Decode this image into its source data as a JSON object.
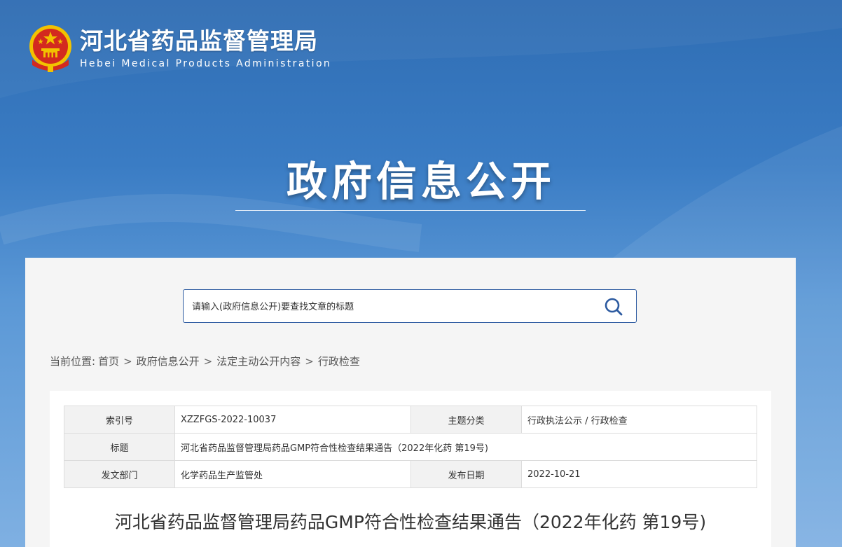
{
  "header": {
    "site_name_cn": "河北省药品监督管理局",
    "site_name_en": "Hebei Medical Products Administration",
    "hero_title": "政府信息公开"
  },
  "search": {
    "placeholder": "请输入(政府信息公开)要查找文章的标题"
  },
  "breadcrumb": {
    "prefix": "当前位置:",
    "items": [
      "首页",
      "政府信息公开",
      "法定主动公开内容",
      "行政检查"
    ],
    "separator": ">"
  },
  "meta": {
    "index_label": "索引号",
    "index_value": "XZZFGS-2022-10037",
    "category_label": "主题分类",
    "category_value": "行政执法公示 / 行政检查",
    "title_label": "标题",
    "title_value": "河北省药品监督管理局药品GMP符合性检查结果通告（2022年化药 第19号)",
    "dept_label": "发文部门",
    "dept_value": "化学药品生产监管处",
    "date_label": "发布日期",
    "date_value": "2022-10-21"
  },
  "article": {
    "title": "河北省药品监督管理局药品GMP符合性检查结果通告（2022年化药 第19号)"
  },
  "colors": {
    "bg_top": "#2f6db3",
    "bg_bottom": "#7fb0e2",
    "border_accent": "#2c5aa0",
    "panel_bg": "#f5f5f5"
  }
}
